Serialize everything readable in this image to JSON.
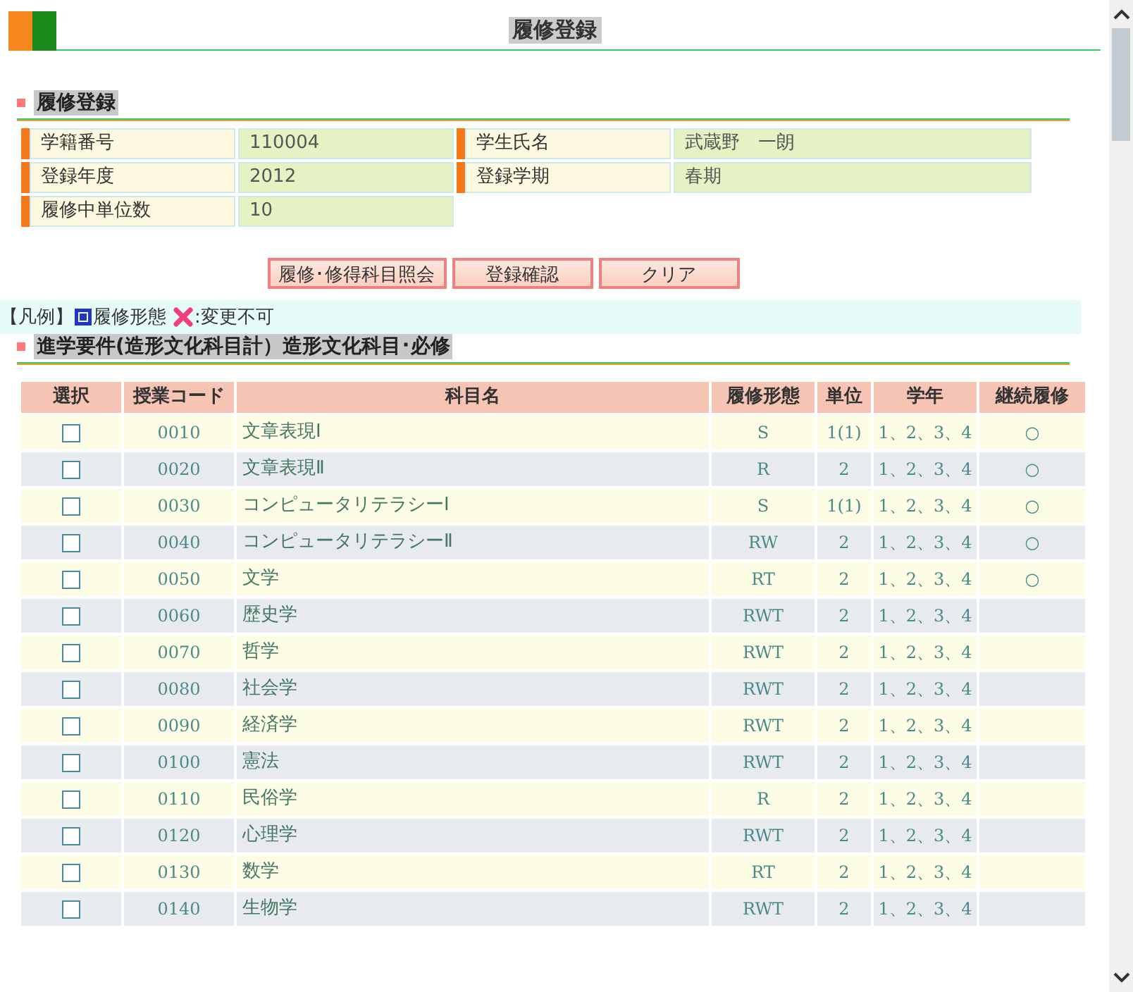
{
  "page_title": "履修登録",
  "section_title": "履修登録",
  "info": [
    {
      "label": "学籍番号",
      "value": "110004"
    },
    {
      "label": "学生氏名",
      "value": "武蔵野　一朗"
    },
    {
      "label": "登録年度",
      "value": "2012"
    },
    {
      "label": "登録学期",
      "value": "春期"
    },
    {
      "label": "履修中単位数",
      "value": "10"
    }
  ],
  "buttons": [
    "履修･修得科目照会",
    "登録確認",
    "クリア"
  ],
  "legend": {
    "prefix": "【凡例】",
    "form_label": "履修形態",
    "locked_label": ":変更不可"
  },
  "course_section_title": "進学要件(造形文化科目計）造形文化科目･必修",
  "table": {
    "columns": [
      "選択",
      "授業コード",
      "科目名",
      "履修形態",
      "単位",
      "学年",
      "継続履修"
    ],
    "rows": [
      {
        "checked": false,
        "code": "0010",
        "name": "文章表現Ⅰ",
        "form": "S",
        "units": "1(1)",
        "grade": "1、2、3、4",
        "continuing": "○"
      },
      {
        "checked": false,
        "code": "0020",
        "name": "文章表現Ⅱ",
        "form": "R",
        "units": "2",
        "grade": "1、2、3、4",
        "continuing": "○"
      },
      {
        "checked": false,
        "code": "0030",
        "name": "コンピュータリテラシーⅠ",
        "form": "S",
        "units": "1(1)",
        "grade": "1、2、3、4",
        "continuing": "○"
      },
      {
        "checked": false,
        "code": "0040",
        "name": "コンピュータリテラシーⅡ",
        "form": "RW",
        "units": "2",
        "grade": "1、2、3、4",
        "continuing": "○"
      },
      {
        "checked": false,
        "code": "0050",
        "name": "文学",
        "form": "RT",
        "units": "2",
        "grade": "1、2、3、4",
        "continuing": "○"
      },
      {
        "checked": false,
        "code": "0060",
        "name": "歴史学",
        "form": "RWT",
        "units": "2",
        "grade": "1、2、3、4"
      },
      {
        "checked": false,
        "code": "0070",
        "name": "哲学",
        "form": "RWT",
        "units": "2",
        "grade": "1、2、3、4"
      },
      {
        "checked": false,
        "code": "0080",
        "name": "社会学",
        "form": "RWT",
        "units": "2",
        "grade": "1、2、3、4"
      },
      {
        "checked": false,
        "code": "0090",
        "name": "経済学",
        "form": "RWT",
        "units": "2",
        "grade": "1、2、3、4"
      },
      {
        "checked": false,
        "code": "0100",
        "name": "憲法",
        "form": "RWT",
        "units": "2",
        "grade": "1、2、3、4"
      },
      {
        "checked": false,
        "code": "0110",
        "name": "民俗学",
        "form": "R",
        "units": "2",
        "grade": "1、2、3、4"
      },
      {
        "checked": false,
        "code": "0120",
        "name": "心理学",
        "form": "RWT",
        "units": "2",
        "grade": "1、2、3、4"
      },
      {
        "checked": false,
        "code": "0130",
        "name": "数学",
        "form": "RT",
        "units": "2",
        "grade": "1、2、3、4"
      },
      {
        "checked": false,
        "code": "0140",
        "name": "生物学",
        "form": "RWT",
        "units": "2",
        "grade": "1、2、3、4"
      }
    ]
  }
}
